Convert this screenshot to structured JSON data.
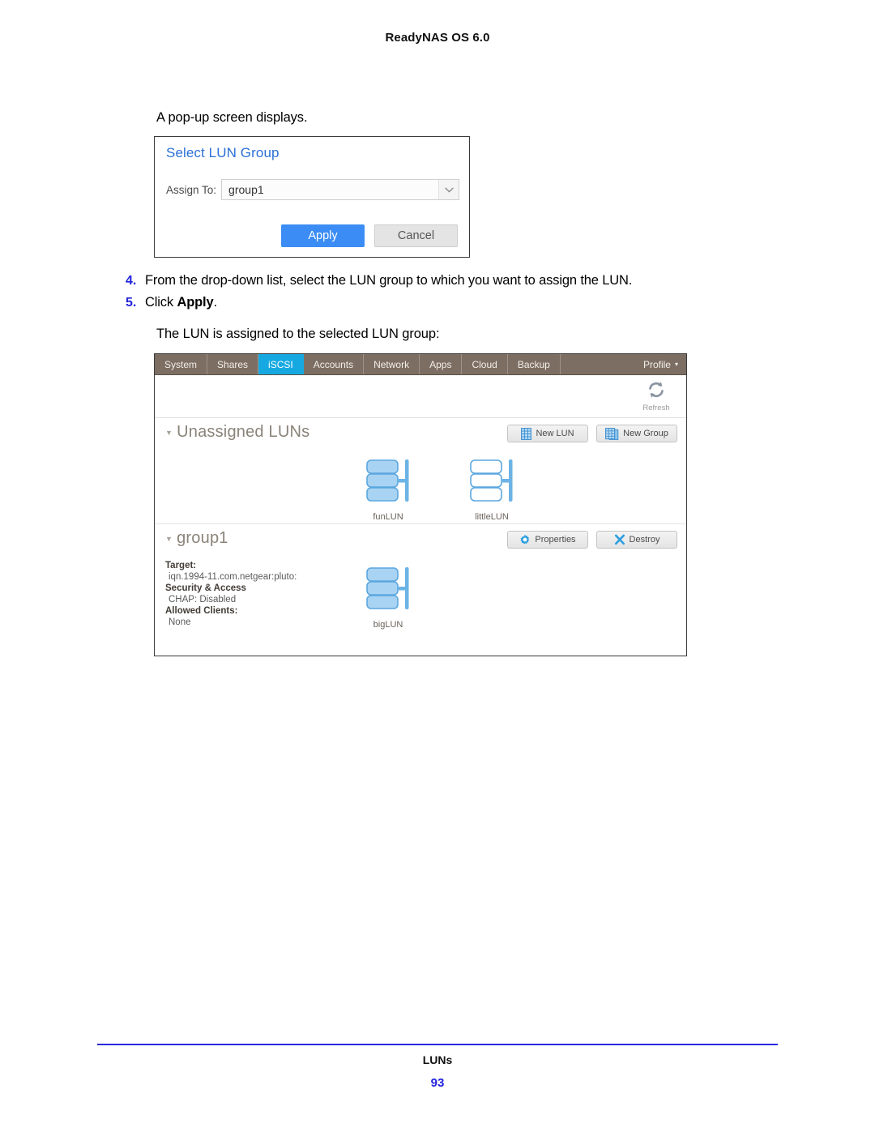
{
  "document": {
    "header_title": "ReadyNAS OS 6.0",
    "intro_line": "A pop-up screen displays.",
    "result_line": "The LUN is assigned to the selected LUN group:",
    "steps": [
      {
        "number": "4.",
        "text": "From the drop-down list, select the LUN group to which you want to assign the LUN.",
        "bold": ""
      },
      {
        "number": "5.",
        "text": "Click ",
        "bold": "Apply",
        "suffix": "."
      }
    ],
    "footer": {
      "title": "LUNs",
      "page_number": "93"
    }
  },
  "popup": {
    "title": "Select LUN Group",
    "assign_label": "Assign To:",
    "assign_value": "group1",
    "assign_options": [
      "group1"
    ],
    "apply_label": "Apply",
    "cancel_label": "Cancel",
    "apply_color": "#3b8cf5"
  },
  "app": {
    "tabs": [
      {
        "label": "System",
        "active": false
      },
      {
        "label": "Shares",
        "active": false
      },
      {
        "label": "iSCSI",
        "active": true
      },
      {
        "label": "Accounts",
        "active": false
      },
      {
        "label": "Network",
        "active": false
      },
      {
        "label": "Apps",
        "active": false
      },
      {
        "label": "Cloud",
        "active": false
      },
      {
        "label": "Backup",
        "active": false
      }
    ],
    "profile_tab": {
      "label": "Profile",
      "caret": "▾"
    },
    "tabbar_color": "#7d6e63",
    "active_tab_color": "#16a9e1",
    "refresh": {
      "label": "Refresh",
      "icon": "refresh-icon"
    },
    "sections": [
      {
        "title": "Unassigned LUNs",
        "collapse_glyph": "▼",
        "actions": [
          {
            "label": "New LUN",
            "icon": "new-lun-icon"
          },
          {
            "label": "New Group",
            "icon": "new-group-icon"
          }
        ],
        "luns": [
          {
            "name": "funLUN",
            "filled": true
          },
          {
            "name": "littleLUN",
            "filled": false
          }
        ]
      },
      {
        "title": "group1",
        "collapse_glyph": "▼",
        "actions": [
          {
            "label": "Properties",
            "icon": "gear-icon"
          },
          {
            "label": "Destroy",
            "icon": "x-icon"
          }
        ],
        "details": [
          {
            "key": "Target:",
            "value": "iqn.1994-11.com.netgear:pluto:"
          },
          {
            "key": "Security & Access",
            "value": "CHAP: Disabled"
          },
          {
            "key": "Allowed Clients:",
            "value": "None"
          }
        ],
        "luns": [
          {
            "name": "bigLUN",
            "filled": true
          }
        ]
      }
    ]
  }
}
